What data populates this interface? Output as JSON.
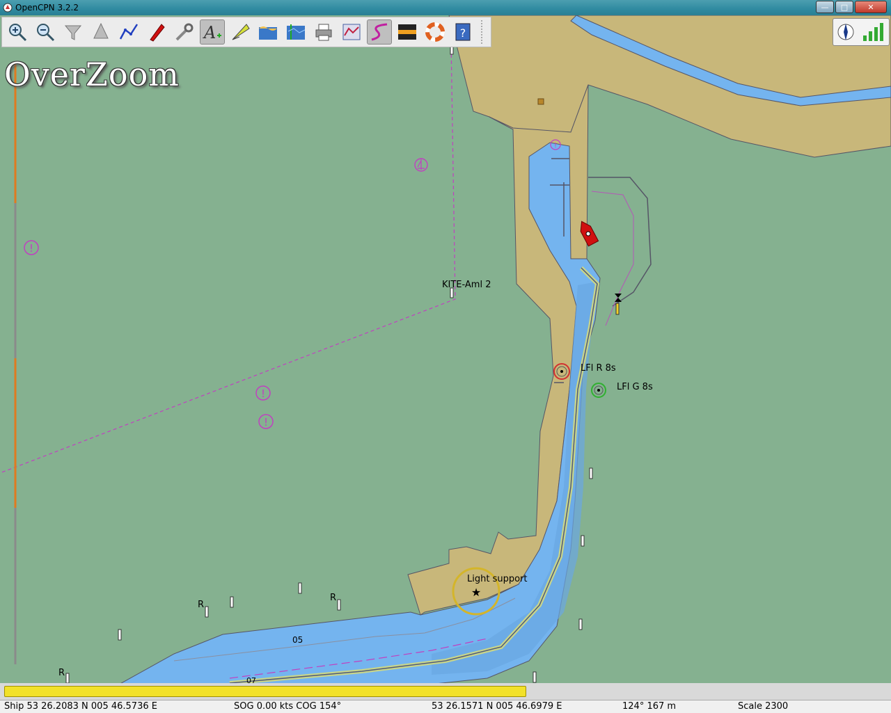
{
  "window": {
    "title": "OpenCPN 3.2.2"
  },
  "window_controls": {
    "minimize": "—",
    "maximize": "□",
    "close": "✕"
  },
  "toolbar": {
    "buttons": [
      {
        "name": "zoom-in",
        "icon": "magnifier-plus-icon"
      },
      {
        "name": "zoom-out",
        "icon": "magnifier-minus-icon"
      },
      {
        "name": "scale-in",
        "icon": "funnel-icon"
      },
      {
        "name": "scale-out",
        "icon": "cone-icon"
      },
      {
        "name": "route",
        "icon": "route-icon"
      },
      {
        "name": "auto-follow",
        "icon": "ship-icon"
      },
      {
        "name": "options",
        "icon": "wrench-icon"
      },
      {
        "name": "text",
        "icon": "text-add-icon",
        "active": true
      },
      {
        "name": "current",
        "icon": "current-icon"
      },
      {
        "name": "tide",
        "icon": "tide-icon"
      },
      {
        "name": "chart-quilt",
        "icon": "chart-icon"
      },
      {
        "name": "print",
        "icon": "printer-icon"
      },
      {
        "name": "route-manager",
        "icon": "route-manager-icon"
      },
      {
        "name": "track",
        "icon": "track-icon",
        "active": true
      },
      {
        "name": "color-scheme",
        "icon": "sunset-icon"
      },
      {
        "name": "mob",
        "icon": "lifebuoy-icon"
      },
      {
        "name": "help",
        "icon": "help-book-icon"
      }
    ]
  },
  "overlay": {
    "overzoom": "OverZoom"
  },
  "chart_labels": {
    "kite": "KITE-Aml 2",
    "lfl_r": "LFl R 8s",
    "lfl_g": "LFl G 8s",
    "light_support": "Light support",
    "r1": "R",
    "r2": "R",
    "r3": "R",
    "depth_05": "05",
    "depth_07": "07"
  },
  "progress": {
    "fraction": 0.59
  },
  "status": {
    "ship": "Ship 53 26.2083 N   005 46.5736 E",
    "sog_cog": "SOG 0.00 kts   COG 154°",
    "cursor": "53 26.1571 N    005 46.6979 E",
    "bearing_dist": "124°   167 m",
    "scale": "Scale 2300"
  },
  "colors": {
    "land": "#c8b77a",
    "water_deep": "#85b190",
    "water_shallow": "#74b4ef",
    "route": "#c040c0",
    "channel": "#c8d58a"
  }
}
